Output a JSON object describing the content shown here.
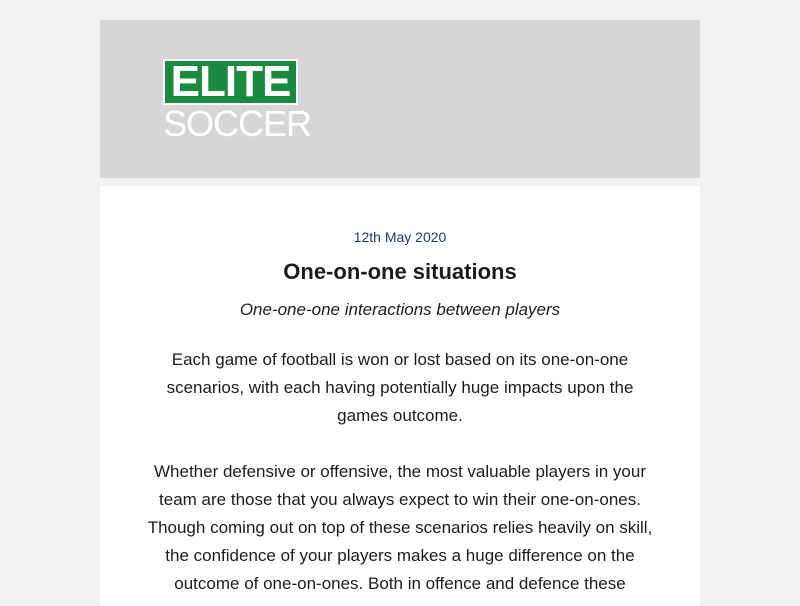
{
  "header": {
    "logo_top": "ELITE",
    "logo_bottom": "SOCCER",
    "background_color": "#d6d6d6",
    "logo_color": "#1a8a3f"
  },
  "article": {
    "date": "12th May 2020",
    "title": "One-on-one situations",
    "subtitle": "One-one-one interactions between players",
    "paragraphs": [
      "Each game of football is won or lost based on its one-on-one scenarios, with each having potentially huge impacts upon the games outcome.",
      "Whether defensive or offensive, the most valuable players in your team are those that you always expect to win their one-on-ones. Though coming out on top of these scenarios relies heavily on skill, the confidence of your players makes a huge difference on the outcome of one-on-ones. Both in offence and defence these"
    ]
  }
}
